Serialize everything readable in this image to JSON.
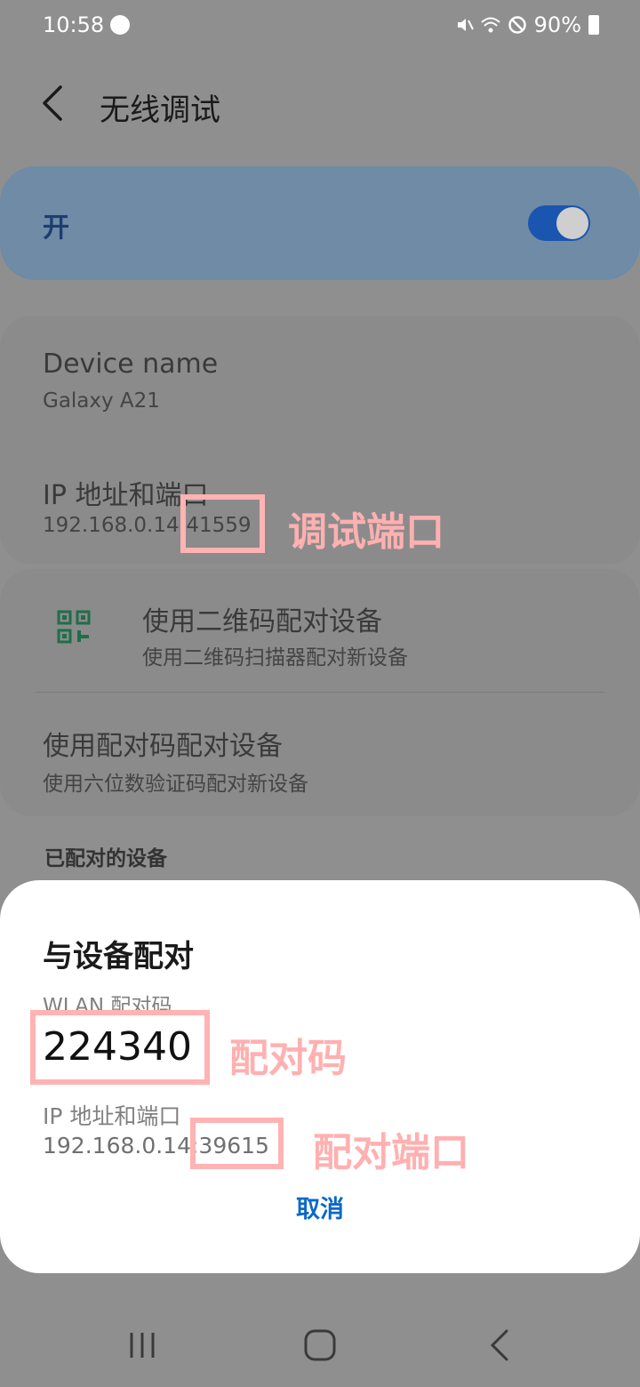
{
  "status_bar": {
    "time": "10:58",
    "battery": "90%"
  },
  "header": {
    "title": "无线调试"
  },
  "switch": {
    "label": "开",
    "state": "on"
  },
  "info": {
    "device_name_title": "Device name",
    "device_name_value": "Galaxy A21",
    "ip_title": "IP 地址和端口",
    "ip_value": "192.168.0.14:41559"
  },
  "pairing_options": {
    "qr_title": "使用二维码配对设备",
    "qr_subtitle": "使用二维码扫描器配对新设备",
    "code_title": "使用配对码配对设备",
    "code_subtitle": "使用六位数验证码配对新设备"
  },
  "paired_devices_header": "已配对的设备",
  "dialog": {
    "title": "与设备配对",
    "code_label": "WLAN 配对码",
    "code_value": "224340",
    "ip_label": "IP 地址和端口",
    "ip_value": "192.168.0.14:39615",
    "cancel_label": "取消"
  },
  "annotations": {
    "debug_port": "调试端口",
    "pair_code": "配对码",
    "pair_port": "配对端口",
    "color": "#ffb3b3"
  },
  "colors": {
    "accent": "#1a56b0",
    "cancel": "#0a69c8"
  }
}
